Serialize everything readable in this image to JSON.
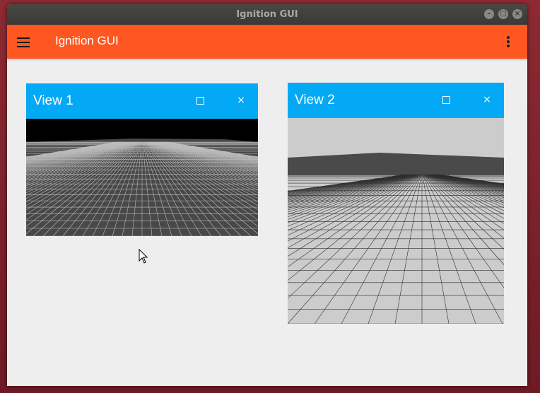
{
  "window": {
    "title": "Ignition GUI"
  },
  "appbar": {
    "title": "Ignition GUI",
    "menu_icon": "hamburger-menu-icon",
    "overflow_icon": "more-vert-icon",
    "color": "#fe5722"
  },
  "plugins": [
    {
      "title": "View 1",
      "maximize_symbol": "□",
      "close_symbol": "×",
      "sky_color": "#000000",
      "ground_color": "#4a4a4a",
      "grid_color": "#cccccc",
      "header_color": "#03a9f4"
    },
    {
      "title": "View 2",
      "maximize_symbol": "□",
      "close_symbol": "×",
      "sky_color": "#cccccc",
      "ground_color": "#cccccc",
      "grid_color": "#333333",
      "header_color": "#03a9f4"
    }
  ]
}
